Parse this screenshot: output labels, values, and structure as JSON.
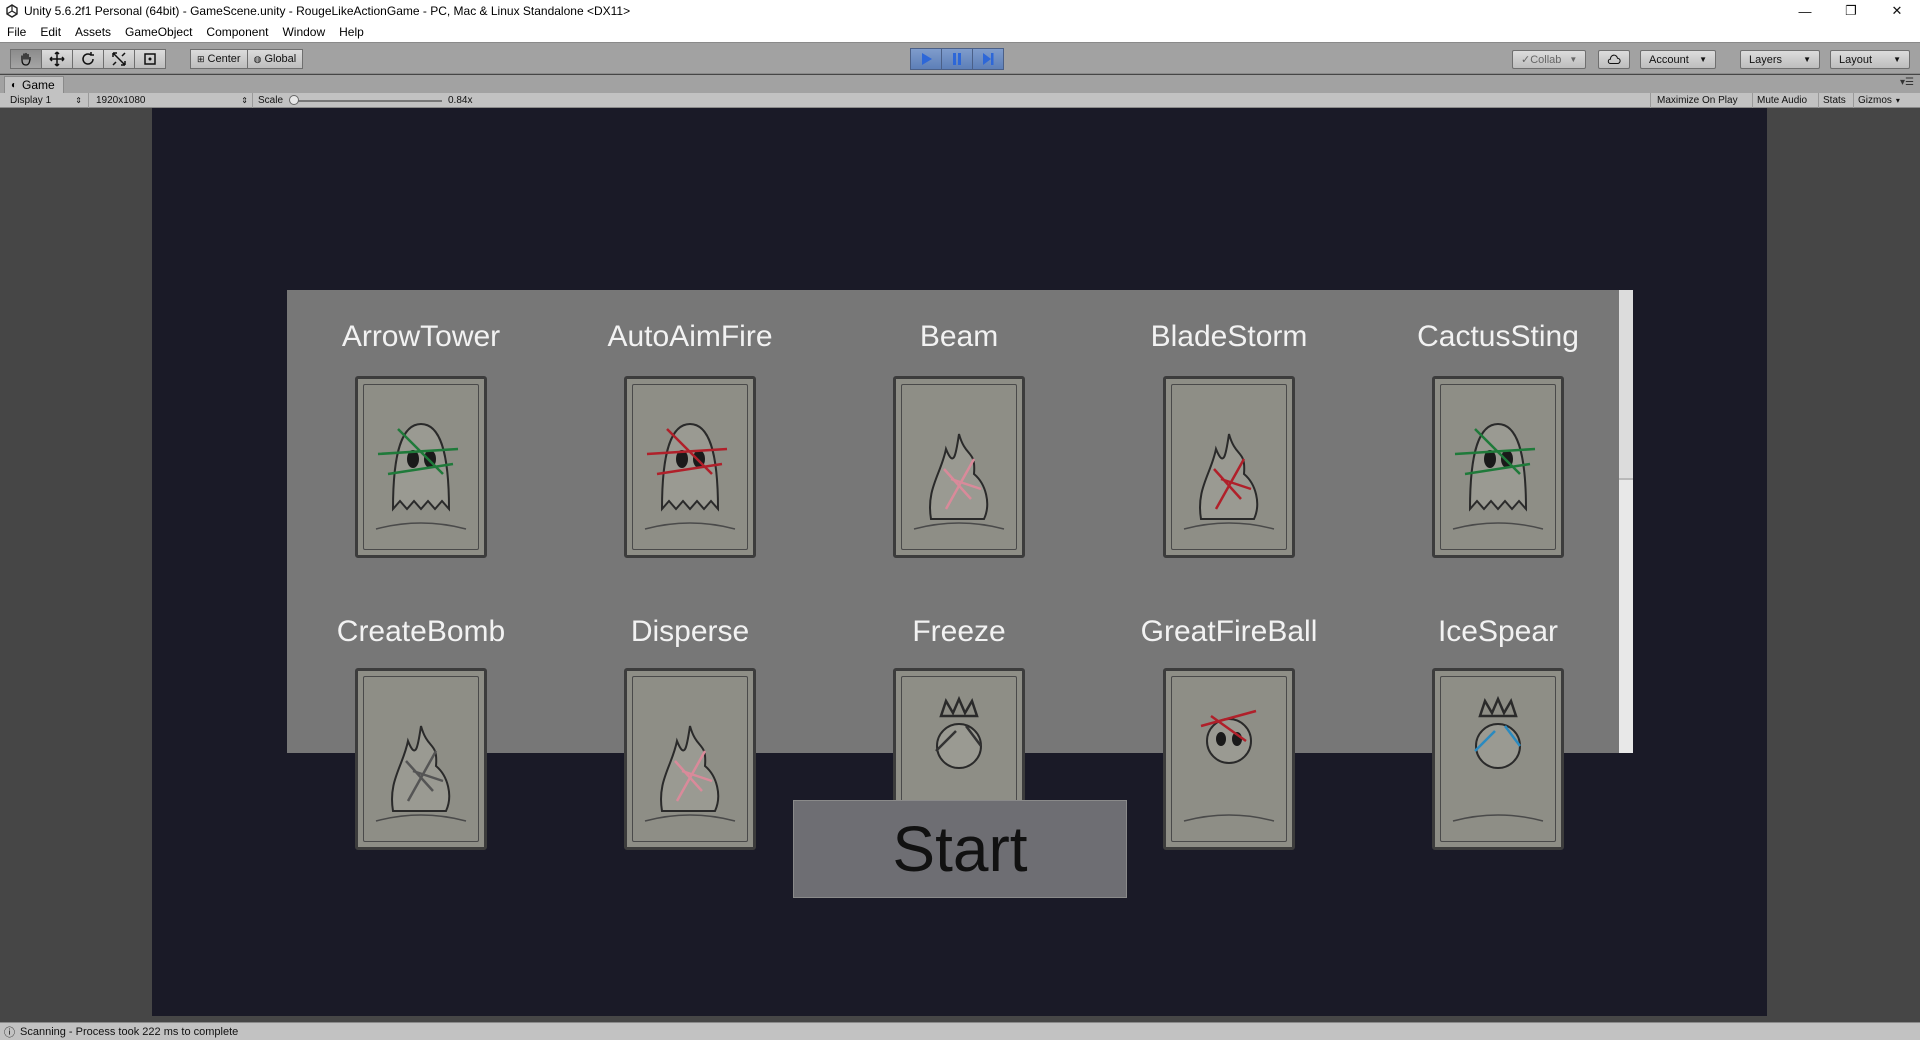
{
  "window": {
    "title": "Unity 5.6.2f1 Personal (64bit) - GameScene.unity - RougeLikeActionGame - PC, Mac & Linux Standalone <DX11>",
    "minimize": "—",
    "restore": "❐",
    "close": "✕"
  },
  "menu": [
    "File",
    "Edit",
    "Assets",
    "GameObject",
    "Component",
    "Window",
    "Help"
  ],
  "toolbar": {
    "tools": [
      "hand-icon",
      "move-icon",
      "rotate-icon",
      "scale-icon",
      "rect-tool-icon"
    ],
    "pivot_label": "Center",
    "space_label": "Global",
    "play_controls": [
      "play-icon",
      "pause-icon",
      "step-icon"
    ],
    "collab_label": "Collab",
    "account_label": "Account",
    "layers_label": "Layers",
    "layout_label": "Layout"
  },
  "game_view": {
    "tab_label": "Game",
    "display_label": "Display 1",
    "resolution_label": "1920x1080",
    "scale_label": "Scale",
    "scale_value": "0.84x",
    "scale_fraction": 0.0,
    "maximize_label": "Maximize On Play",
    "mute_label": "Mute Audio",
    "stats_label": "Stats",
    "gizmos_label": "Gizmos"
  },
  "skills": [
    {
      "name": "ArrowTower",
      "art": "ghost",
      "stroke": "#1f7a3a"
    },
    {
      "name": "AutoAimFire",
      "art": "ghost",
      "stroke": "#b0202a"
    },
    {
      "name": "Beam",
      "art": "fire",
      "stroke": "#d98a9a"
    },
    {
      "name": "BladeStorm",
      "art": "fire",
      "stroke": "#b0202a"
    },
    {
      "name": "CactusSting",
      "art": "ghost",
      "stroke": "#1f7a3a"
    },
    {
      "name": "CreateBomb",
      "art": "fire",
      "stroke": "#555555"
    },
    {
      "name": "Disperse",
      "art": "fire",
      "stroke": "#d98a9a"
    },
    {
      "name": "Freeze",
      "art": "crown",
      "stroke": "#333333"
    },
    {
      "name": "GreatFireBall",
      "art": "skull",
      "stroke": "#b0202a"
    },
    {
      "name": "IceSpear",
      "art": "crown",
      "stroke": "#2a8ac0"
    }
  ],
  "start_button": "Start",
  "status_text": "Scanning - Process took 222 ms to complete",
  "colors": {
    "game_background": "#1a1a27",
    "panel": "#777777",
    "play_active": "#5d7fb8"
  }
}
